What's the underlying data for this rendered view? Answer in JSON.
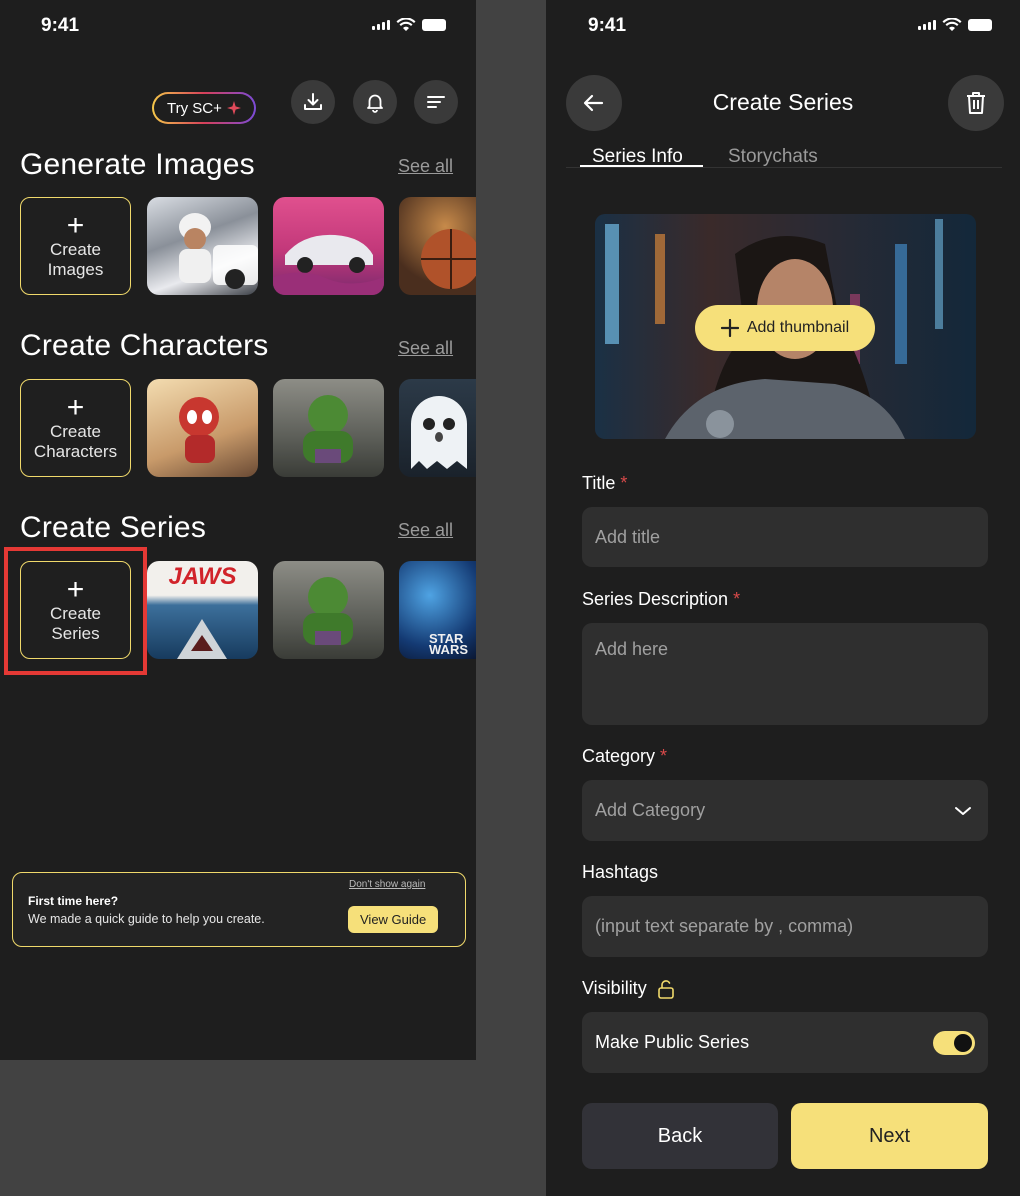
{
  "left": {
    "status": {
      "time": "9:41"
    },
    "header": {
      "try_label": "Try SC+"
    },
    "sections": [
      {
        "title": "Generate Images",
        "see_all": "See all",
        "create_lines": [
          "Create",
          "Images"
        ]
      },
      {
        "title": "Create Characters",
        "see_all": "See all",
        "create_lines": [
          "Create",
          "Characters"
        ]
      },
      {
        "title": "Create Series",
        "see_all": "See all",
        "create_lines": [
          "Create",
          "Series"
        ]
      }
    ],
    "series_posters": {
      "jaws": "JAWS",
      "star": "STAR",
      "wars": "WARS"
    },
    "banner": {
      "dismiss": "Don't show again",
      "title": "First time here?",
      "text": "We made a quick guide to help you create.",
      "button": "View Guide"
    }
  },
  "right": {
    "status": {
      "time": "9:41"
    },
    "title": "Create Series",
    "tabs": [
      "Series Info",
      "Storychats"
    ],
    "thumbnail_button": "Add thumbnail",
    "fields": {
      "title_label": "Title",
      "title_placeholder": "Add title",
      "description_label": "Series Description",
      "description_placeholder": "Add here",
      "category_label": "Category",
      "category_placeholder": "Add Category",
      "hashtags_label": "Hashtags",
      "hashtags_placeholder": "(input text separate by , comma)",
      "visibility_label": "Visibility",
      "visibility_option": "Make Public Series",
      "public": true
    },
    "buttons": {
      "back": "Back",
      "next": "Next"
    }
  },
  "colors": {
    "accent": "#f6e07a",
    "background": "#1e1e1e",
    "highlight": "#e53935",
    "required": "#d94a4a"
  }
}
